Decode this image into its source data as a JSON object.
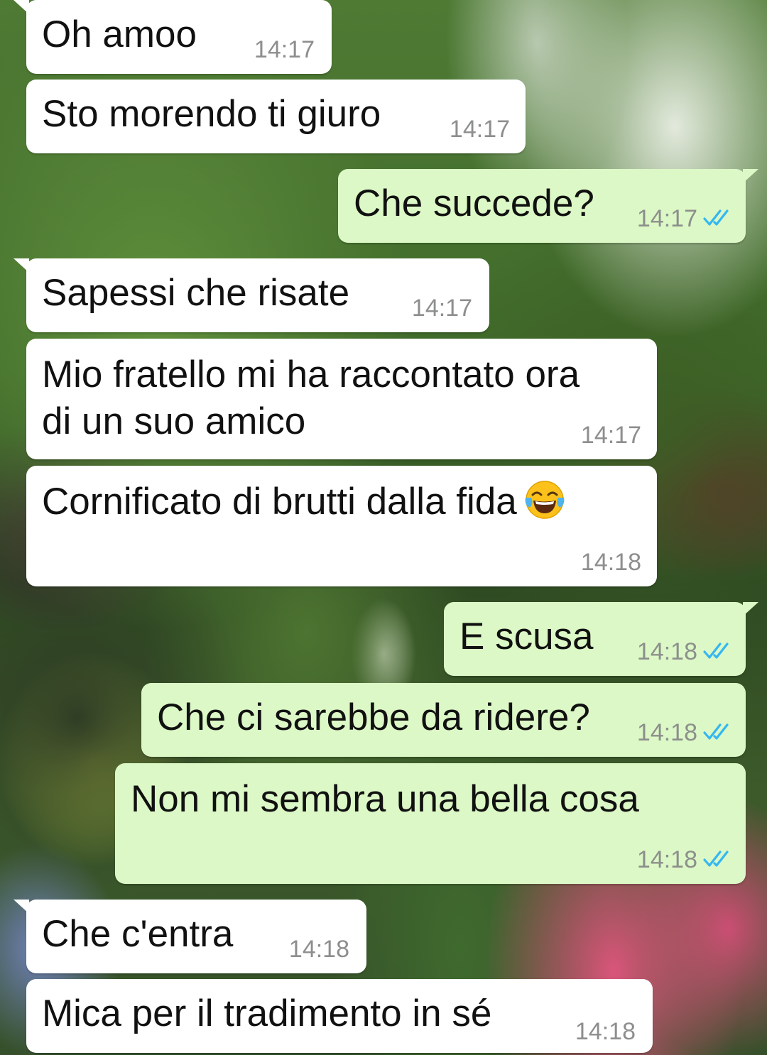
{
  "colors": {
    "incoming_bubble": "#ffffff",
    "outgoing_bubble": "#dcf8c6",
    "timestamp": "#8c8f8c",
    "read_ticks": "#34b7f1"
  },
  "messages": [
    {
      "direction": "in",
      "text": "Oh amoo",
      "time": "14:17"
    },
    {
      "direction": "in",
      "text": "Sto morendo ti giuro",
      "time": "14:17"
    },
    {
      "direction": "out",
      "text": "Che succede?",
      "time": "14:17",
      "status": "read"
    },
    {
      "direction": "in",
      "text": "Sapessi che risate",
      "time": "14:17"
    },
    {
      "direction": "in",
      "text_lines": [
        "Mio fratello mi ha raccontato ora",
        "di un suo amico"
      ],
      "time": "14:17"
    },
    {
      "direction": "in",
      "text": "Cornificato di brutti dalla fida",
      "emoji": "face-with-tears-of-joy",
      "time": "14:18"
    },
    {
      "direction": "out",
      "text": "E scusa",
      "time": "14:18",
      "status": "read"
    },
    {
      "direction": "out",
      "text": "Che ci sarebbe da ridere?",
      "time": "14:18",
      "status": "read"
    },
    {
      "direction": "out",
      "text": "Non mi sembra una bella cosa",
      "time": "14:18",
      "status": "read"
    },
    {
      "direction": "in",
      "text": "Che c'entra",
      "time": "14:18"
    },
    {
      "direction": "in",
      "text": "Mica per il tradimento in sé",
      "time": "14:18"
    }
  ]
}
